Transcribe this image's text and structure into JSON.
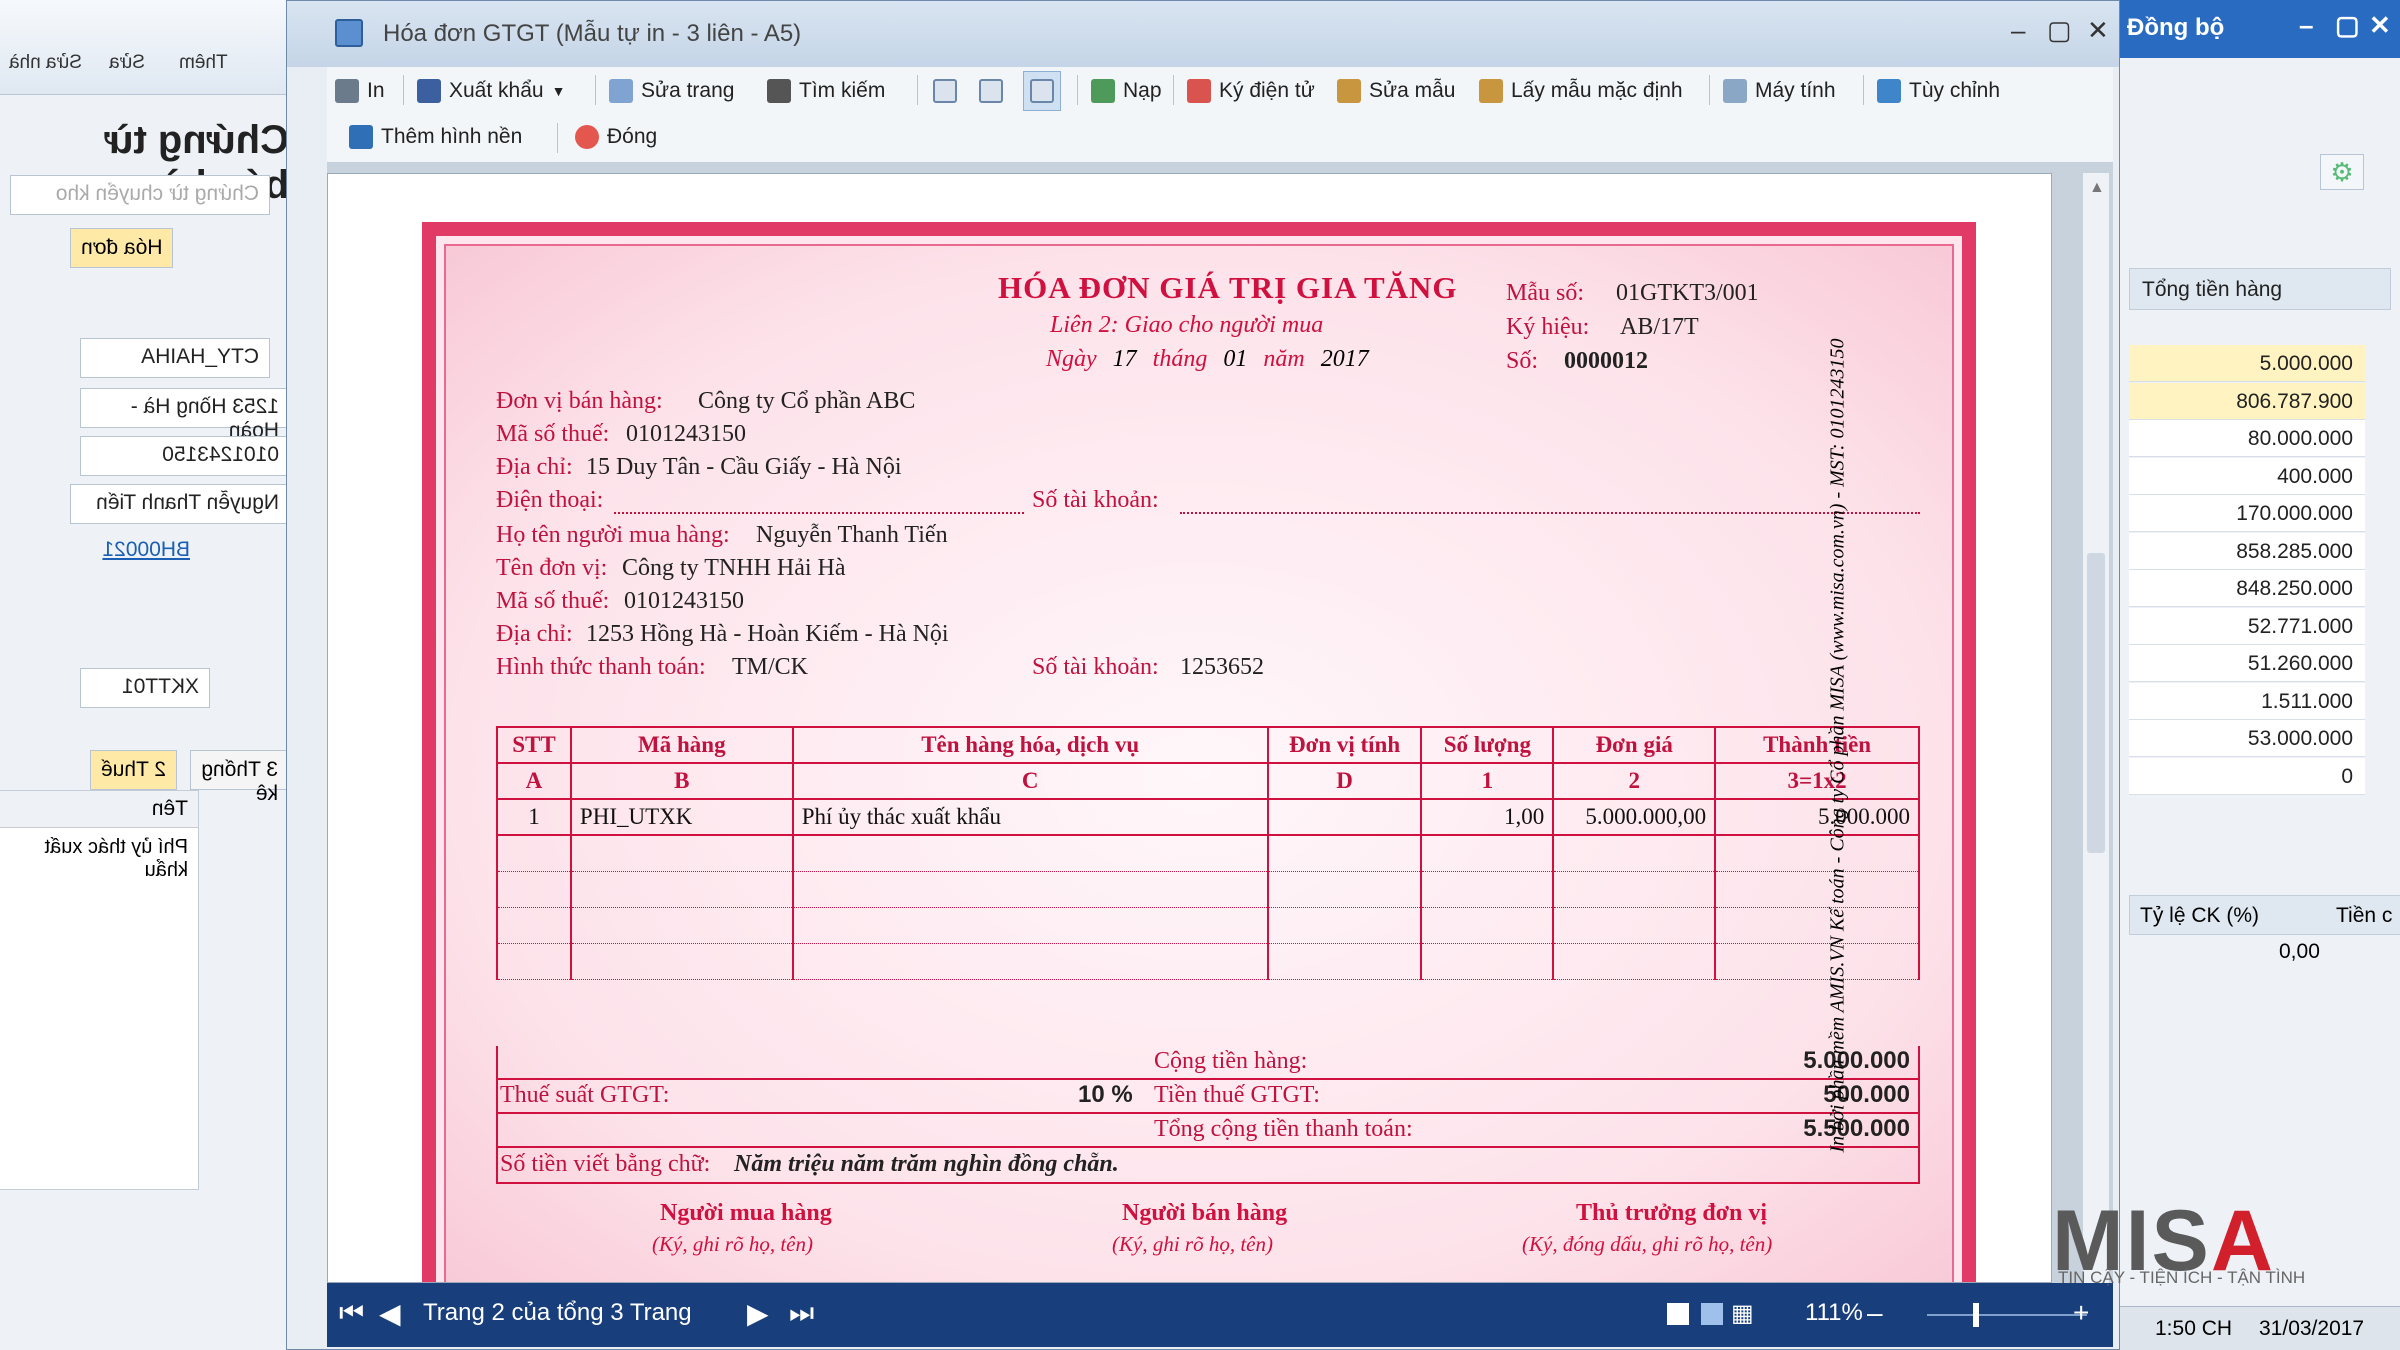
{
  "window": {
    "title": "Hóa đơn GTGT (Mẫu tự in - 3 liên - A5)"
  },
  "toolbar": {
    "print": "In",
    "export": "Xuất khẩu",
    "edit_page": "Sửa trang",
    "search": "Tìm kiếm",
    "load": "Nạp",
    "esign": "Ký điện tử",
    "edit_template": "Sửa mẫu",
    "default_template": "Lấy mẫu mặc định",
    "calculator": "Máy tính",
    "customize": "Tùy chỉnh",
    "add_background": "Thêm hình nền",
    "close": "Đóng"
  },
  "invoice": {
    "title": "HÓA ĐƠN GIÁ TRỊ GIA TĂNG",
    "copy_line": "Liên 2: Giao cho người mua",
    "date_ngay": "Ngày",
    "date_day": "17",
    "date_thang": "tháng",
    "date_month": "01",
    "date_nam": "năm",
    "date_year": "2017",
    "form_no_label": "Mẫu số:",
    "form_no": "01GTKT3/001",
    "symbol_label": "Ký hiệu:",
    "symbol": "AB/17T",
    "number_label": "Số:",
    "number": "0000012",
    "seller_label": "Đơn vị bán hàng:",
    "seller": "Công ty Cổ phần ABC",
    "seller_tax_label": "Mã số thuế:",
    "seller_tax": "0101243150",
    "seller_addr_label": "Địa chỉ:",
    "seller_addr": "15 Duy Tân - Cầu Giấy - Hà Nội",
    "phone_label": "Điện thoại:",
    "account_label": "Số tài khoản:",
    "buyer_name_label": "Họ tên người mua hàng:",
    "buyer_name": "Nguyễn Thanh Tiến",
    "buyer_unit_label": "Tên đơn vị:",
    "buyer_unit": "Công ty TNHH Hải Hà",
    "buyer_tax_label": "Mã số thuế:",
    "buyer_tax": "0101243150",
    "buyer_addr_label": "Địa chỉ:",
    "buyer_addr": "1253 Hồng Hà - Hoàn Kiếm - Hà Nội",
    "payment_label": "Hình thức thanh toán:",
    "payment": "TM/CK",
    "buyer_account_label": "Số tài khoản:",
    "buyer_account": "1253652",
    "columns": [
      "STT",
      "Mã hàng",
      "Tên hàng hóa, dịch vụ",
      "Đơn vị tính",
      "Số lượng",
      "Đơn giá",
      "Thành tiền"
    ],
    "column_codes": [
      "A",
      "B",
      "C",
      "D",
      "1",
      "2",
      "3=1x2"
    ],
    "rows": [
      {
        "stt": "1",
        "code": "PHI_UTXK",
        "name": "Phí ủy thác xuất khẩu",
        "unit": "",
        "qty": "1,00",
        "price": "5.000.000,00",
        "amount": "5.000.000"
      }
    ],
    "subtotal_label": "Cộng tiền hàng:",
    "subtotal": "5.000.000",
    "vat_rate_label": "Thuế suất GTGT:",
    "vat_rate": "10 %",
    "vat_amount_label": "Tiền thuế GTGT:",
    "vat_amount": "500.000",
    "grand_total_label": "Tổng cộng tiền thanh toán:",
    "grand_total": "5.500.000",
    "in_words_label": "Số tiền viết bằng chữ:",
    "in_words": "Năm triệu năm trăm nghìn đồng chẵn.",
    "sig_buyer": "Người mua hàng",
    "sig_buyer_note": "(Ký, ghi rõ họ, tên)",
    "sig_seller": "Người bán hàng",
    "sig_seller_note": "(Ký, ghi rõ họ, tên)",
    "sig_head": "Thủ trưởng đơn vị",
    "sig_head_note": "(Ký, đóng dấu, ghi rõ họ, tên)",
    "vertical_note": "In bởi phần mềm AMIS.VN Kế toán - Công ty Cổ phần MISA (www.misa.com.vn) - MST: 0101243150"
  },
  "statusbar": {
    "page_info": "Trang 2 của tổng 3 Trang",
    "zoom": "111%"
  },
  "background_left": {
    "ribbon_items": [
      "Sửa nhà",
      "Sửa",
      "Thêm"
    ],
    "title": "Chứng từ bán hàng",
    "placeholder": "Chứng từ chuyển kho",
    "tab_invoice": "Hóa đơn",
    "fields": [
      "CTY_HAIHA",
      "1253 Hồng Hà - Hoàn",
      "0101243150",
      "Nguyễn Thanh Tiến",
      "BH00021",
      "XKTT01"
    ],
    "tabs": [
      "2 Thuế",
      "3 Thống kê"
    ],
    "col_name": "Tên",
    "row_text": "Phí ủy thác xuất khẩu"
  },
  "background_right": {
    "sync": "Đồng bộ",
    "col_total": "Tổng tiền hàng",
    "values": [
      "5.000.000",
      "806.787.900",
      "80.000.000",
      "400.000",
      "170.000.000",
      "858.285.000",
      "848.250.000",
      "52.771.000",
      "51.260.000",
      "1.511.000",
      "53.000.000",
      "0"
    ],
    "col_discount": "Tỷ lệ CK (%)",
    "col_next": "Tiền c",
    "discount_value": "0,00",
    "time": "1:50 CH",
    "date": "31/03/2017"
  },
  "brand": {
    "logo": "MISA",
    "tagline": "TIN CẬY - TIỆN ÍCH - TẬN TÌNH"
  }
}
